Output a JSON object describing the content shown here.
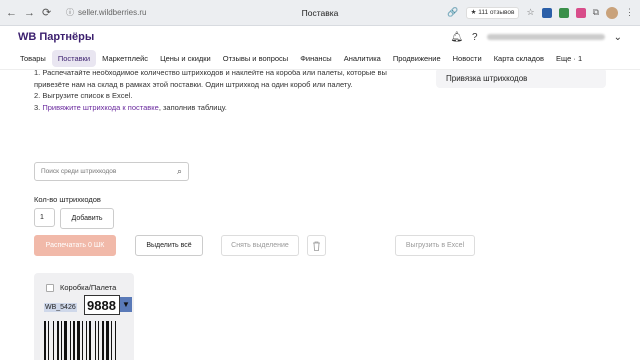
{
  "browser": {
    "url": "seller.wildberries.ru",
    "tab_title": "Поставка",
    "reviews_badge": "★ 111 отзывов"
  },
  "header": {
    "logo": "WB Партнёры"
  },
  "nav": {
    "tabs": [
      {
        "label": "Товары",
        "active": false
      },
      {
        "label": "Поставки",
        "active": true
      },
      {
        "label": "Маркетплейс",
        "active": false
      },
      {
        "label": "Цены и скидки",
        "active": false
      },
      {
        "label": "Отзывы и вопросы",
        "active": false
      },
      {
        "label": "Финансы",
        "active": false
      },
      {
        "label": "Аналитика",
        "active": false
      },
      {
        "label": "Продвижение",
        "active": false
      },
      {
        "label": "Новости",
        "active": false
      },
      {
        "label": "Карта складов",
        "active": false
      },
      {
        "label": "Еще · 1",
        "active": false
      }
    ]
  },
  "instructions": {
    "step1_line1": "1. Распечатайте необходимое количество штрихкодов и наклейте на короба или палеты, которые вы",
    "step1_line2": "привезёте нам на склад в рамках этой поставки. Один штрихкод на один короб или палету.",
    "step2": "2. Выгрузите список в Excel.",
    "step3_prefix": "3. ",
    "step3_link": "Привяжите штрихкода к поставке",
    "step3_suffix": ", заполнив таблицу."
  },
  "side_card": {
    "label": "Привязка штрихкодов"
  },
  "search": {
    "placeholder": "Поиск среди штрихкодов"
  },
  "quantity": {
    "label": "Кол-во штрихкодов",
    "value": "1",
    "add_button": "Добавить"
  },
  "actions": {
    "print": "Распечатать 0 ШК",
    "select_all": "Выделить всё",
    "deselect": "Снять выделение",
    "export": "Выгрузить в Excel"
  },
  "barcode_card": {
    "title": "Коробка/Палета",
    "code_prefix": "WB_5426",
    "code_value": "9888"
  },
  "colors": {
    "brand": "#3b1f6e",
    "link": "#6a2a9e",
    "primary_disabled": "#f1b9a9"
  }
}
